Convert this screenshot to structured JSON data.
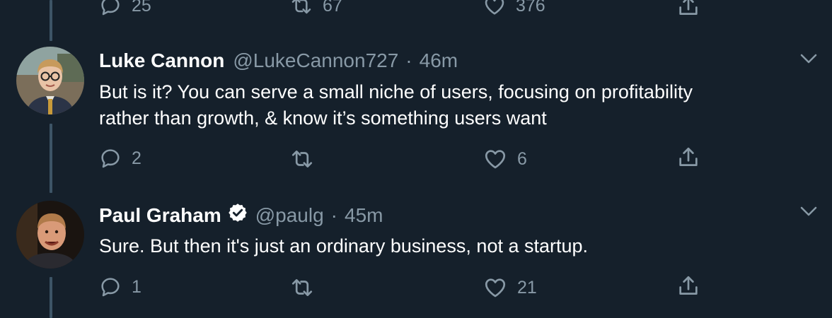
{
  "top_tweet": {
    "reply_count": "25",
    "retweet_count": "67",
    "like_count": "376"
  },
  "tweets": [
    {
      "name": "Luke Cannon",
      "handle": "@LukeCannon727",
      "dot": "·",
      "time": "46m",
      "verified": false,
      "text_line1": "But is it? You can serve a small niche of users, focusing on profitability",
      "text_line2": "rather than growth, & know it’s something users want",
      "reply_count": "2",
      "retweet_count": "",
      "like_count": "6"
    },
    {
      "name": "Paul Graham",
      "handle": "@paulg",
      "dot": "·",
      "time": "45m",
      "verified": true,
      "text_line1": "Sure. But then it's just an ordinary business, not a startup.",
      "reply_count": "1",
      "retweet_count": "",
      "like_count": "21"
    }
  ],
  "colors": {
    "background": "#15202b",
    "secondary_text": "#8899a6",
    "thread_line": "#3d5466",
    "verified_badge": "#ffffff"
  },
  "icons": [
    "reply-icon",
    "retweet-icon",
    "like-icon",
    "share-icon",
    "chevron-down-icon",
    "verified-badge-icon"
  ]
}
